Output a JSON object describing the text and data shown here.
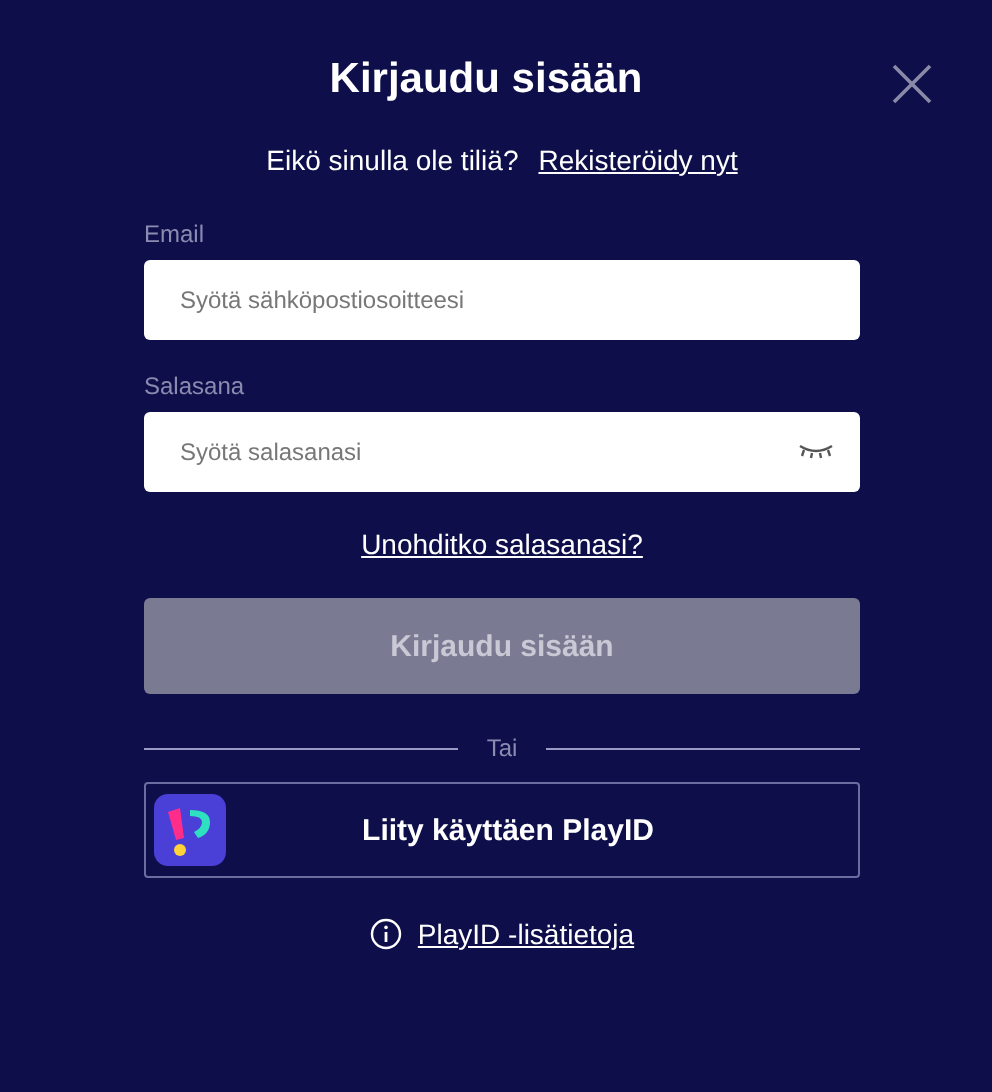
{
  "title": "Kirjaudu sisään",
  "register_prompt": {
    "text": "Eikö sinulla ole tiliä?",
    "link": "Rekisteröidy nyt"
  },
  "fields": [
    {
      "kind": "email",
      "label": "Email",
      "placeholder": "Syötä sähköpostiosoitteesi"
    },
    {
      "kind": "password",
      "label": "Salasana",
      "placeholder": "Syötä salasanasi"
    }
  ],
  "forgot_link": "Unohditko salasanasi?",
  "submit": {
    "label": "Kirjaudu sisään",
    "disabled": true
  },
  "divider": "Tai",
  "playid_button": "Liity käyttäen PlayID",
  "info_link": "PlayID -lisätietoja"
}
